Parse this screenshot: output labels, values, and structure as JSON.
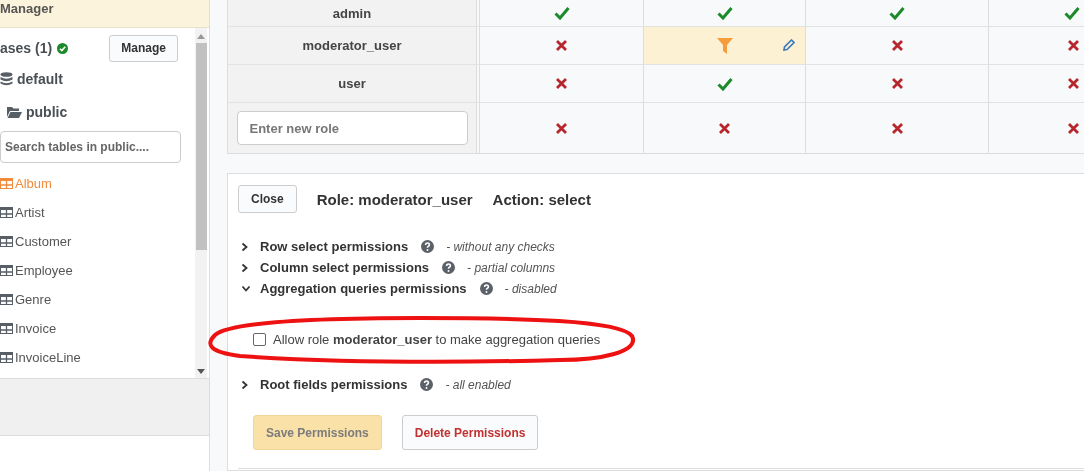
{
  "sidebar": {
    "header": "Manager",
    "databases": {
      "label": "ases (1)",
      "connected": true,
      "button": "Manage"
    },
    "database": "default",
    "schema": "public",
    "search": {
      "placeholder": "Search tables in public...."
    },
    "tables": [
      {
        "name": "Album",
        "selected": true
      },
      {
        "name": "Artist",
        "selected": false
      },
      {
        "name": "Customer",
        "selected": false
      },
      {
        "name": "Employee",
        "selected": false
      },
      {
        "name": "Genre",
        "selected": false
      },
      {
        "name": "Invoice",
        "selected": false
      },
      {
        "name": "InvoiceLine",
        "selected": false
      }
    ]
  },
  "permissions_table": {
    "rows": [
      {
        "kind": "role",
        "role": "admin",
        "cells": [
          {
            "kind": "allowed",
            "selected": false
          },
          {
            "kind": "allowed",
            "selected": false
          },
          {
            "kind": "allowed",
            "selected": false
          },
          {
            "kind": "allowed",
            "selected": false
          }
        ]
      },
      {
        "kind": "role",
        "role": "moderator_user",
        "cells": [
          {
            "kind": "denied",
            "selected": false
          },
          {
            "kind": "partial",
            "selected": true
          },
          {
            "kind": "denied",
            "selected": false
          },
          {
            "kind": "denied",
            "selected": false
          }
        ]
      },
      {
        "kind": "role",
        "role": "user",
        "cells": [
          {
            "kind": "denied",
            "selected": false
          },
          {
            "kind": "allowed",
            "selected": false
          },
          {
            "kind": "denied",
            "selected": false
          },
          {
            "kind": "denied",
            "selected": false
          }
        ]
      },
      {
        "kind": "new",
        "placeholder": "Enter new role",
        "cells": [
          {
            "kind": "denied",
            "selected": false
          },
          {
            "kind": "denied",
            "selected": false
          },
          {
            "kind": "denied",
            "selected": false
          },
          {
            "kind": "denied",
            "selected": false
          }
        ]
      }
    ]
  },
  "editor": {
    "close": "Close",
    "role_title": "Role: moderator_user",
    "action_title": "Action: select",
    "sections": [
      {
        "title": "Row select permissions",
        "note": "- without any checks",
        "expanded": false
      },
      {
        "title": "Column select permissions",
        "note": "- partial columns",
        "expanded": false
      },
      {
        "title": "Aggregation queries permissions",
        "note": "- disabled",
        "expanded": true,
        "option": {
          "label": "Allow role **moderator_user** to make aggregation queries",
          "checked": false
        }
      },
      {
        "title": "Root fields permissions",
        "note": "- all enabled",
        "expanded": false
      }
    ],
    "save": {
      "label": "Save Permissions",
      "disabled": true
    },
    "delete": "Delete Permissions"
  }
}
